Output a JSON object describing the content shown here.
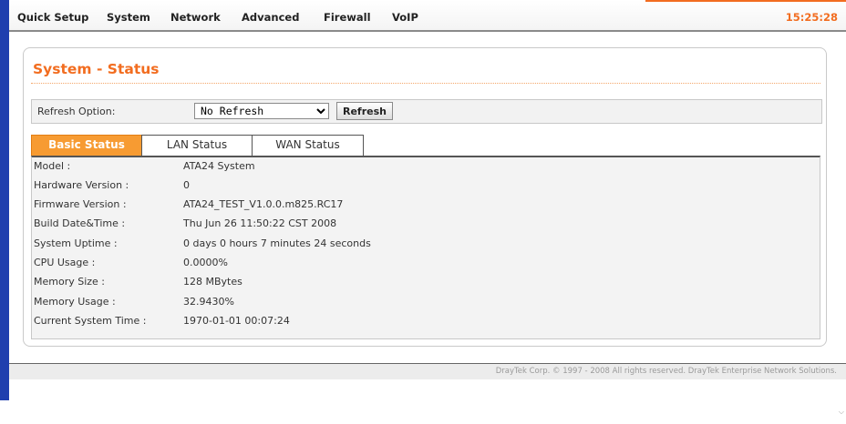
{
  "nav": {
    "items": [
      {
        "label": "Quick Setup"
      },
      {
        "label": "System"
      },
      {
        "label": "Network"
      },
      {
        "label": "Advanced"
      },
      {
        "label": "Firewall"
      },
      {
        "label": "VoIP"
      }
    ],
    "clock": "15:25:28"
  },
  "page": {
    "title": "System - Status"
  },
  "refresh": {
    "label": "Refresh Option:",
    "selected": "No Refresh",
    "button_label": "Refresh"
  },
  "tabs": [
    {
      "label": "Basic Status",
      "active": true
    },
    {
      "label": "LAN Status",
      "active": false
    },
    {
      "label": "WAN Status",
      "active": false
    }
  ],
  "status": [
    {
      "label": "Model :",
      "value": "ATA24 System"
    },
    {
      "label": "Hardware Version :",
      "value": "0"
    },
    {
      "label": "Firmware Version :",
      "value": "ATA24_TEST_V1.0.0.m825.RC17"
    },
    {
      "label": "Build Date&Time :",
      "value": "Thu Jun 26 11:50:22 CST 2008"
    },
    {
      "label": "System Uptime :",
      "value": "0 days 0 hours 7 minutes 24 seconds"
    },
    {
      "label": "CPU Usage :",
      "value": "0.0000%"
    },
    {
      "label": "Memory Size :",
      "value": "128 MBytes"
    },
    {
      "label": "Memory Usage :",
      "value": "32.9430%"
    },
    {
      "label": "Current System Time :",
      "value": "1970-01-01 00:07:24"
    }
  ],
  "footer": {
    "text": "DrayTek Corp. © 1997 - 2008 All rights reserved. DrayTek Enterprise Network Solutions."
  },
  "colors": {
    "accent": "#f26d20",
    "tab_active": "#f79b32",
    "left_bar": "#1f3fae"
  }
}
